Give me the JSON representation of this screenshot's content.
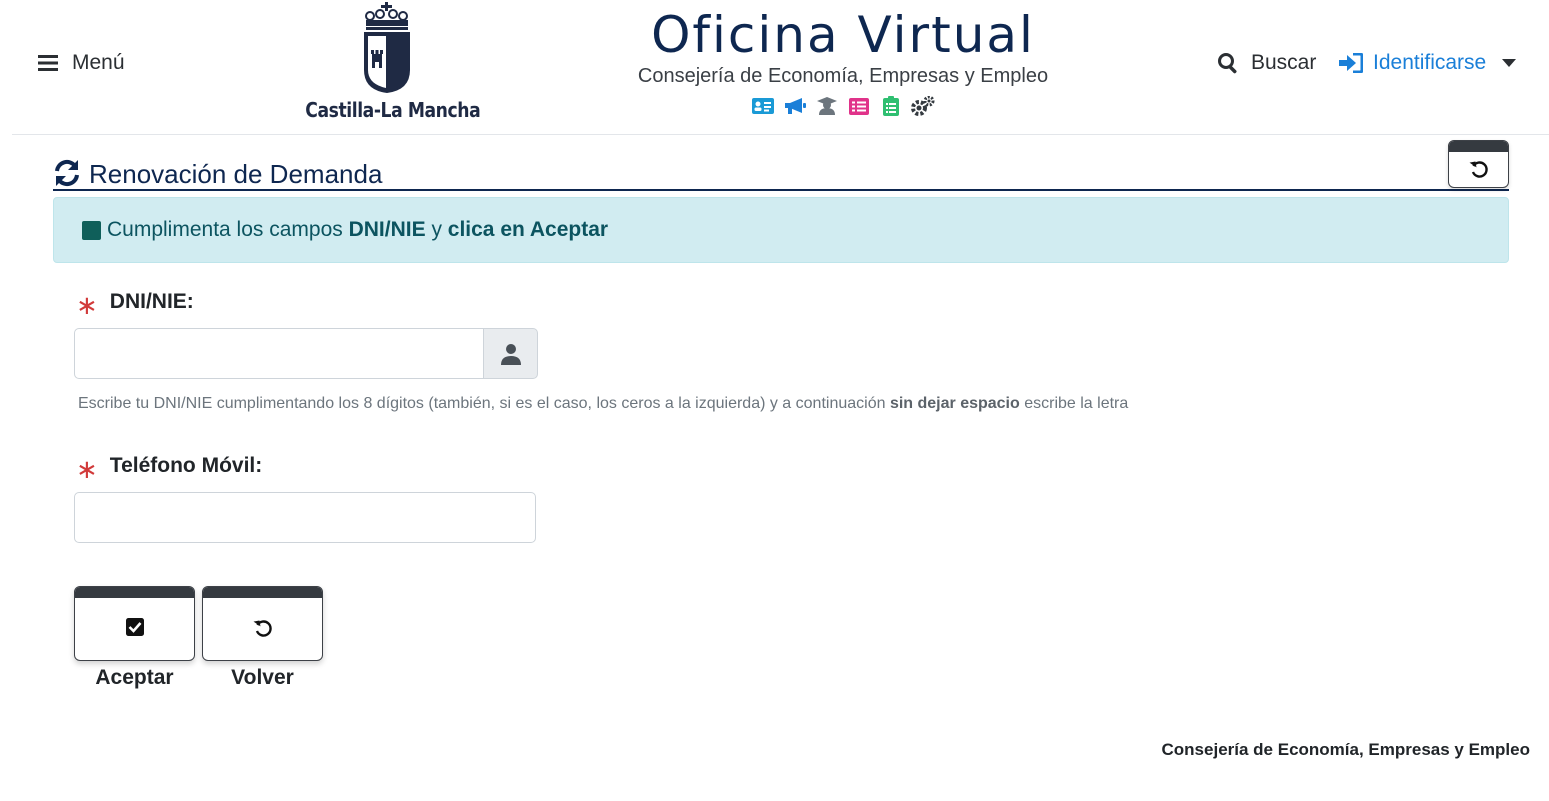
{
  "header": {
    "menu_label": "Menú",
    "logo_text": "Castilla-La Mancha",
    "brand_title": "Oficina Virtual",
    "brand_subtitle": "Consejería de Economía, Empresas y Empleo",
    "brand_icons": [
      {
        "name": "id-card-icon",
        "color": "#1a9ad6"
      },
      {
        "name": "megaphone-icon",
        "color": "#1a7fd8"
      },
      {
        "name": "graduate-icon",
        "color": "#6c757d"
      },
      {
        "name": "list-icon",
        "color": "#e0338a"
      },
      {
        "name": "clipboard-icon",
        "color": "#2fbf71"
      },
      {
        "name": "cogs-icon",
        "color": "#343a40"
      }
    ],
    "search_label": "Buscar",
    "login_label": "Identificarse"
  },
  "page": {
    "title": "Renovación de Demanda"
  },
  "alert": {
    "text_1": "Cumplimenta los campos ",
    "bold_1": "DNI/NIE",
    "text_2": " y ",
    "bold_2": "clica en Aceptar"
  },
  "form": {
    "dni": {
      "label": "DNI/NIE:",
      "value": "",
      "help_1": "Escribe tu DNI/NIE cumplimentando los 8 dígitos (también, si es el caso, los ceros a la izquierda) y a continuación ",
      "help_bold": "sin dejar espacio",
      "help_2": " escribe la letra"
    },
    "phone": {
      "label": "Teléfono Móvil:",
      "value": ""
    },
    "required_mark": "∗"
  },
  "actions": {
    "accept_label": "Aceptar",
    "back_label": "Volver"
  },
  "footer": {
    "text": "Consejería de Economía, Empresas y Empleo"
  },
  "colors": {
    "brand": "#0e2750",
    "link": "#1a7fd8",
    "alert_bg": "#d1ecf1",
    "required": "#d13a3a"
  }
}
